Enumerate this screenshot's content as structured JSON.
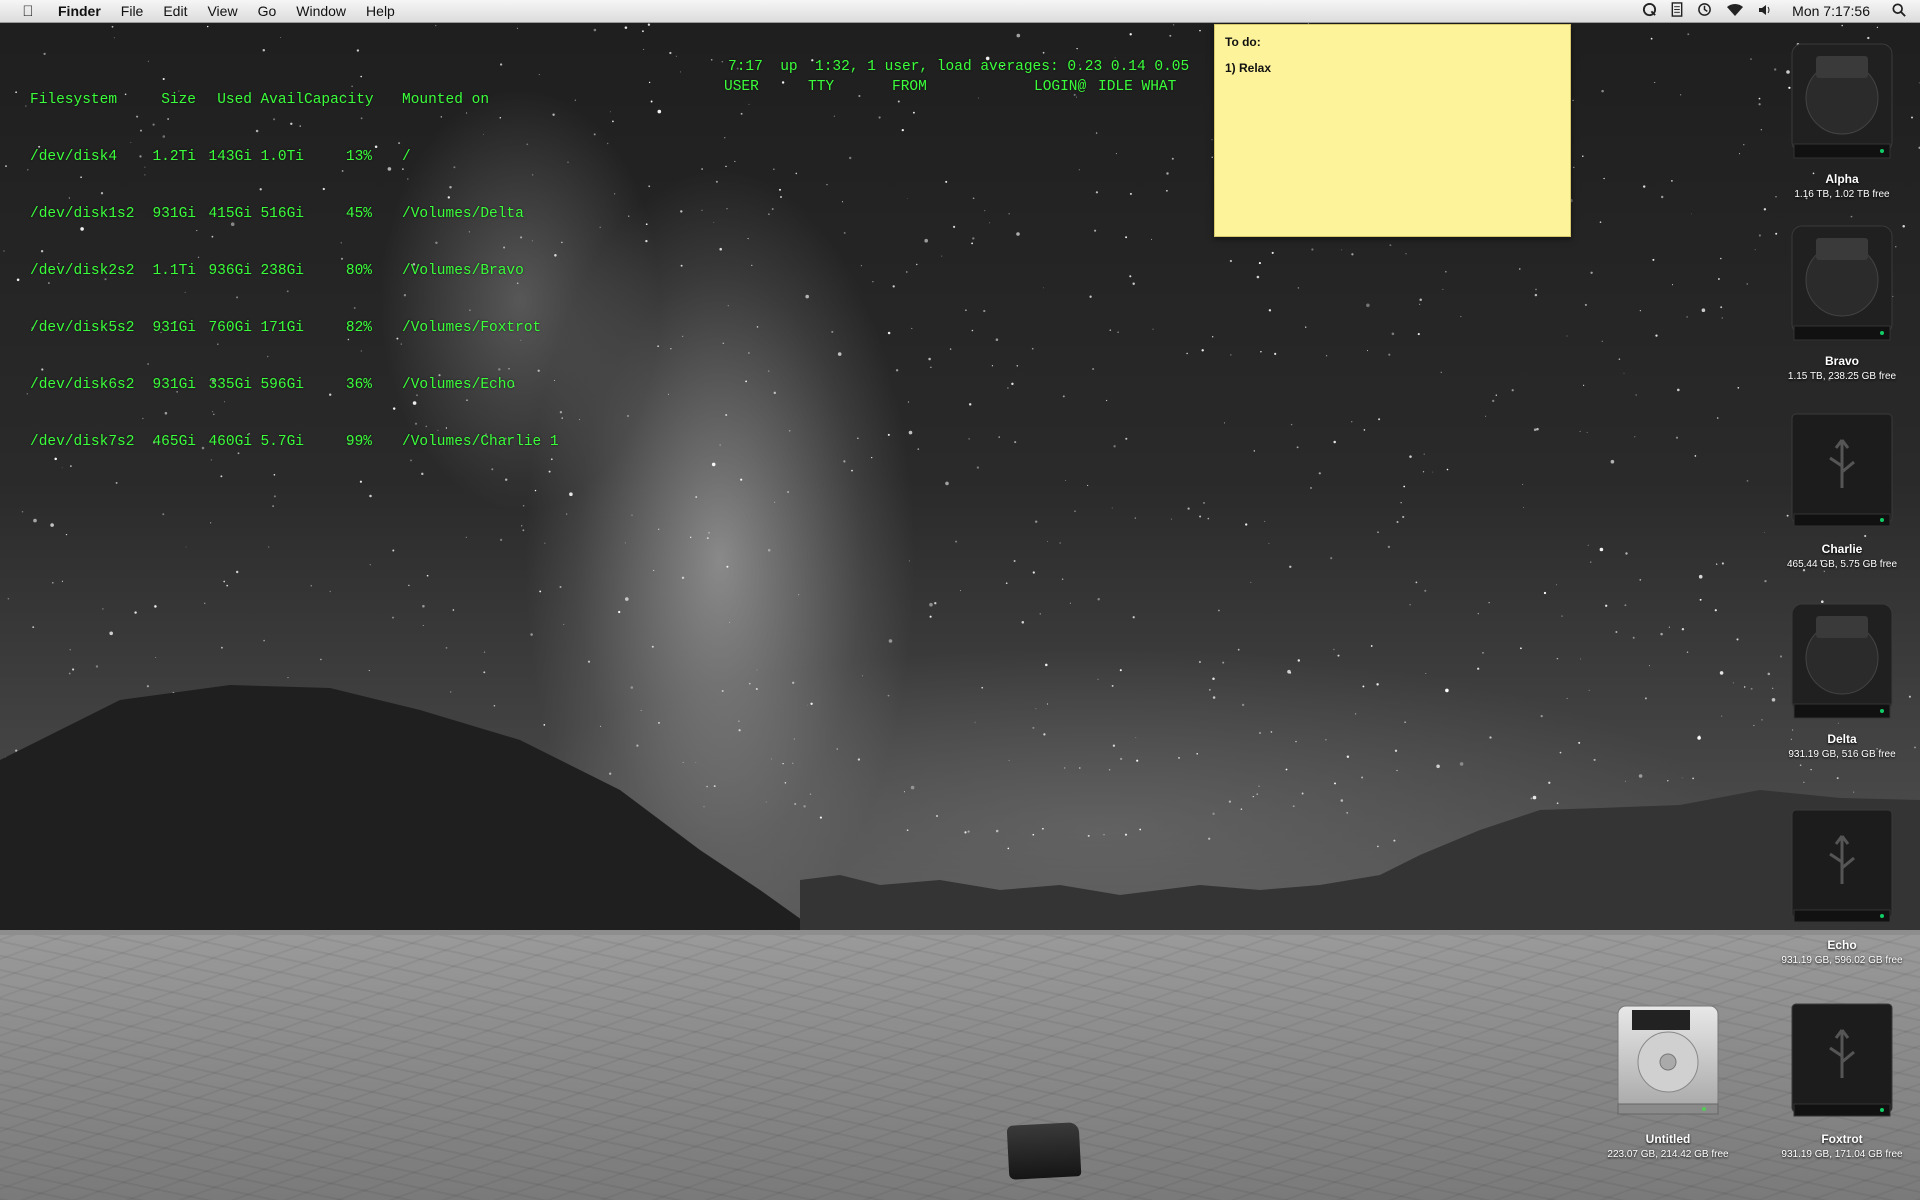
{
  "menubar": {
    "app_name": "Finder",
    "menus": [
      "File",
      "Edit",
      "View",
      "Go",
      "Window",
      "Help"
    ],
    "clock": "Mon 7:17:56",
    "status_icons": [
      "quicktime-icon",
      "script-icon",
      "time-machine-icon",
      "wifi-icon",
      "volume-icon",
      "spotlight-icon"
    ]
  },
  "terminal": {
    "df_header": [
      "Filesystem",
      "Size",
      "Used",
      "Avail",
      "Capacity",
      "Mounted on"
    ],
    "df_rows": [
      [
        "/dev/disk4",
        "1.2Ti",
        "143Gi",
        "1.0Ti",
        "13%",
        "/"
      ],
      [
        "/dev/disk1s2",
        "931Gi",
        "415Gi",
        "516Gi",
        "45%",
        "/Volumes/Delta"
      ],
      [
        "/dev/disk2s2",
        "1.1Ti",
        "936Gi",
        "238Gi",
        "80%",
        "/Volumes/Bravo"
      ],
      [
        "/dev/disk5s2",
        "931Gi",
        "760Gi",
        "171Gi",
        "82%",
        "/Volumes/Foxtrot"
      ],
      [
        "/dev/disk6s2",
        "931Gi",
        "335Gi",
        "596Gi",
        "36%",
        "/Volumes/Echo"
      ],
      [
        "/dev/disk7s2",
        "465Gi",
        "460Gi",
        "5.7Gi",
        "99%",
        "/Volumes/Charlie 1"
      ]
    ],
    "uptime": "7:17  up  1:32, 1 user, load averages: 0.23 0.14 0.05",
    "who_header": [
      "USER",
      "TTY",
      "FROM",
      "LOGIN@",
      "IDLE WHAT"
    ]
  },
  "sticky": {
    "title": "To do:",
    "line1": "1) Relax"
  },
  "drives": [
    {
      "name": "Alpha",
      "info": "1.16 TB, 1.02 TB free",
      "kind": "mac-hd"
    },
    {
      "name": "Bravo",
      "info": "1.15 TB, 238.25 GB free",
      "kind": "mac-hd"
    },
    {
      "name": "Charlie",
      "info": "465.44 GB, 5.75 GB free",
      "kind": "usb"
    },
    {
      "name": "Delta",
      "info": "931.19 GB, 516 GB free",
      "kind": "mac-hd"
    },
    {
      "name": "Echo",
      "info": "931.19 GB, 596.02 GB free",
      "kind": "usb"
    },
    {
      "name": "Foxtrot",
      "info": "931.19 GB, 171.04 GB free",
      "kind": "usb"
    },
    {
      "name": "Untitled",
      "info": "223.07 GB, 214.42 GB free",
      "kind": "internal"
    }
  ],
  "colors": {
    "terminal_text": "#3bff3b",
    "sticky_bg": "#fdf39b"
  }
}
